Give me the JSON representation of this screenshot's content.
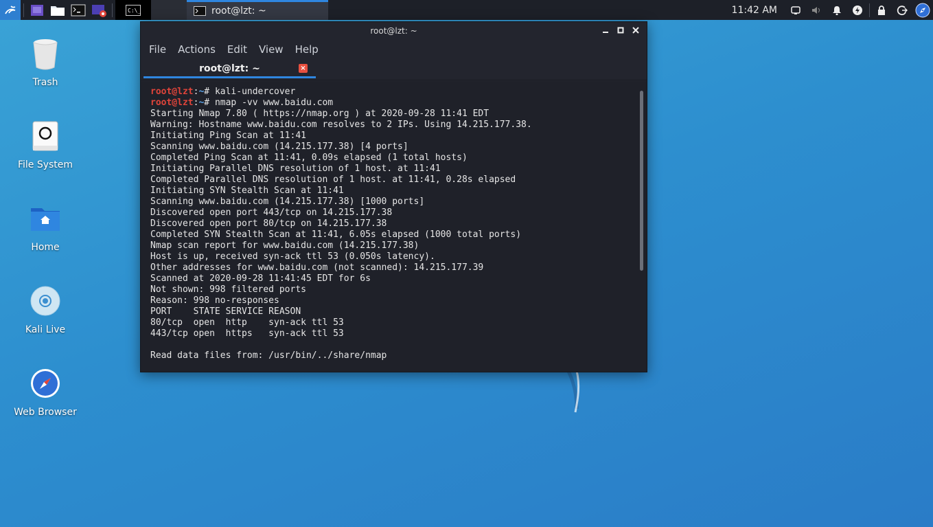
{
  "panel": {
    "icons": [
      "kali-menu-icon",
      "screen-tool-icon",
      "file-manager-icon",
      "terminal-icon",
      "screen-recorder-icon"
    ],
    "task_title": "root@lzt: ~",
    "clock": "11:42 AM"
  },
  "desktop": {
    "icons": [
      {
        "label": "Trash"
      },
      {
        "label": "File System"
      },
      {
        "label": "Home"
      },
      {
        "label": "Kali Live"
      },
      {
        "label": "Web Browser"
      }
    ]
  },
  "window": {
    "title": "root@lzt: ~",
    "menu": [
      "File",
      "Actions",
      "Edit",
      "View",
      "Help"
    ],
    "tab": {
      "label": "root@lzt: ~",
      "close": "×"
    }
  },
  "terminal": {
    "prompt_user": "root@lzt",
    "prompt_sep": ":",
    "prompt_path": "~",
    "prompt_hash": "# ",
    "commands": [
      "kali-undercover",
      "nmap -vv www.baidu.com"
    ],
    "output": [
      "Starting Nmap 7.80 ( https://nmap.org ) at 2020-09-28 11:41 EDT",
      "Warning: Hostname www.baidu.com resolves to 2 IPs. Using 14.215.177.38.",
      "Initiating Ping Scan at 11:41",
      "Scanning www.baidu.com (14.215.177.38) [4 ports]",
      "Completed Ping Scan at 11:41, 0.09s elapsed (1 total hosts)",
      "Initiating Parallel DNS resolution of 1 host. at 11:41",
      "Completed Parallel DNS resolution of 1 host. at 11:41, 0.28s elapsed",
      "Initiating SYN Stealth Scan at 11:41",
      "Scanning www.baidu.com (14.215.177.38) [1000 ports]",
      "Discovered open port 443/tcp on 14.215.177.38",
      "Discovered open port 80/tcp on 14.215.177.38",
      "Completed SYN Stealth Scan at 11:41, 6.05s elapsed (1000 total ports)",
      "Nmap scan report for www.baidu.com (14.215.177.38)",
      "Host is up, received syn-ack ttl 53 (0.050s latency).",
      "Other addresses for www.baidu.com (not scanned): 14.215.177.39",
      "Scanned at 2020-09-28 11:41:45 EDT for 6s",
      "Not shown: 998 filtered ports",
      "Reason: 998 no-responses",
      "PORT    STATE SERVICE REASON",
      "80/tcp  open  http    syn-ack ttl 53",
      "443/tcp open  https   syn-ack ttl 53",
      "",
      "Read data files from: /usr/bin/../share/nmap"
    ]
  },
  "colors": {
    "accent": "#2f86e0",
    "prompt_user": "#e0443a",
    "prompt_path": "#5aa3e8",
    "terminal_bg": "#1f2129"
  }
}
